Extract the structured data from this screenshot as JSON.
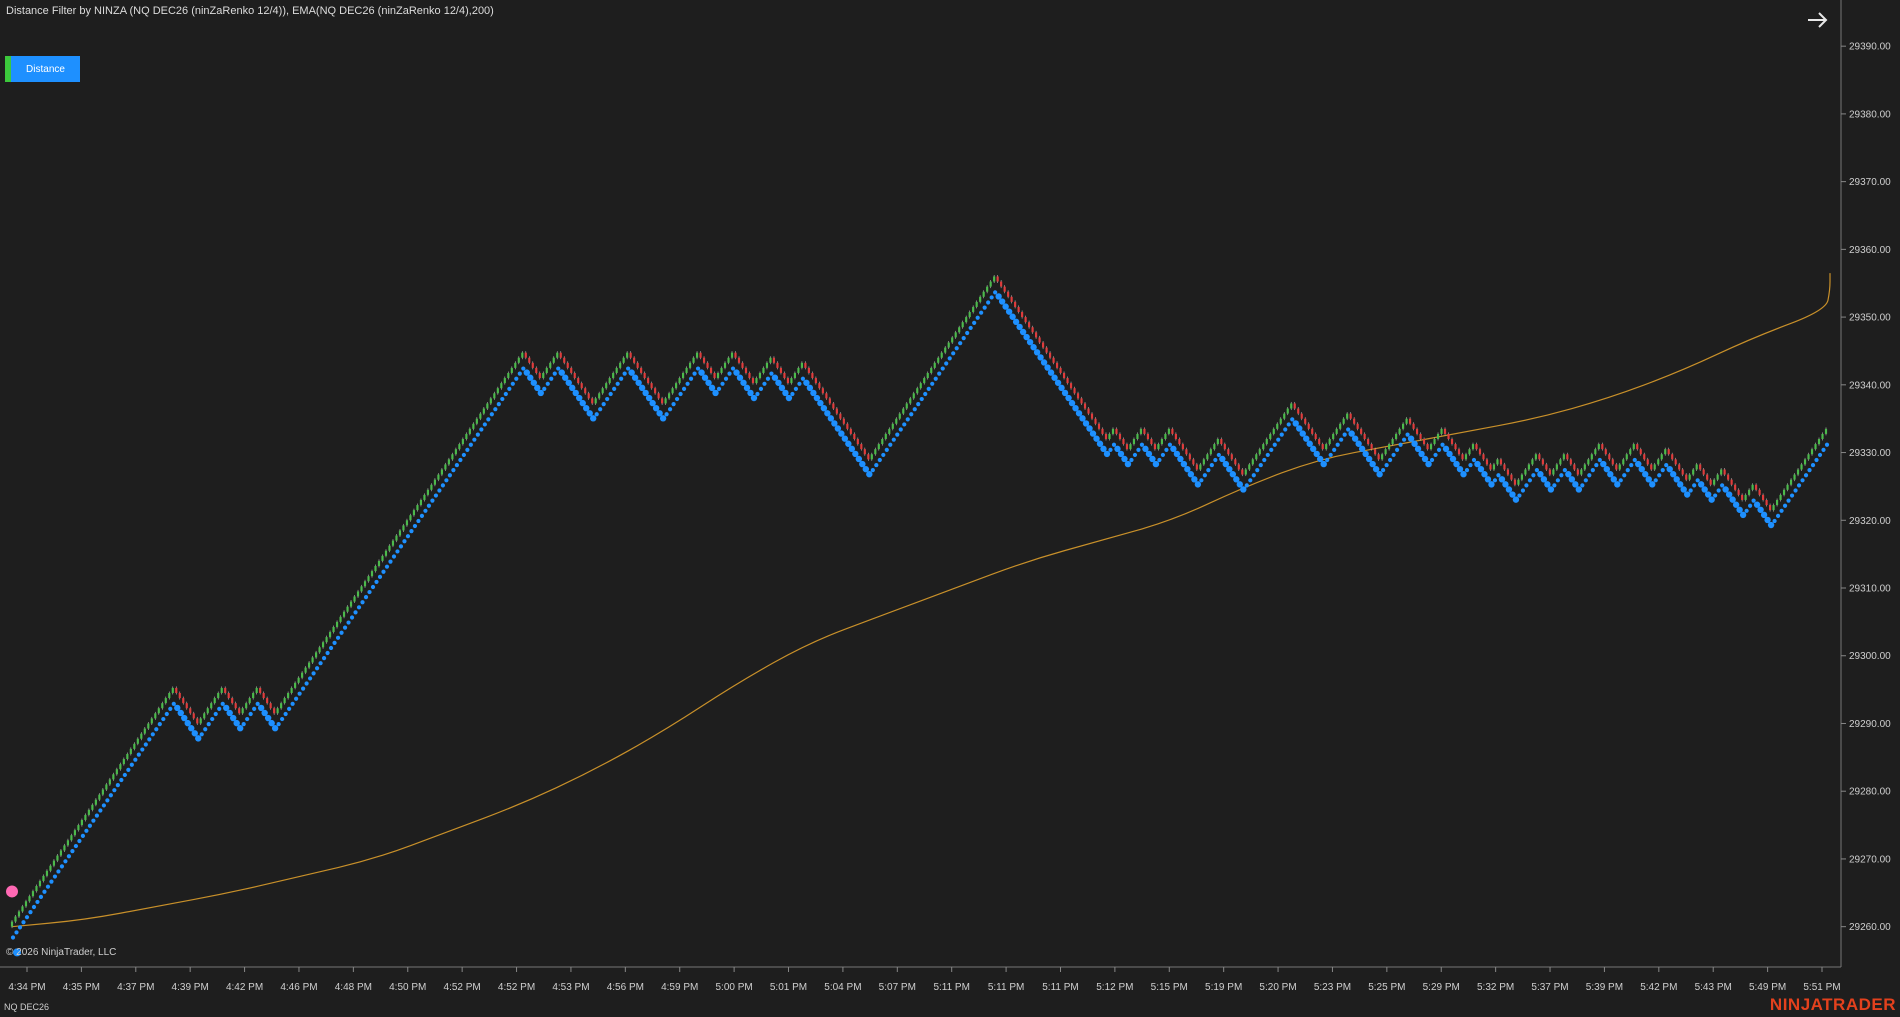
{
  "header": {
    "title": "Distance Filter by NINZA (NQ DEC26 (ninZaRenko 12/4)), EMA(NQ DEC26 (ninZaRenko 12/4),200)"
  },
  "controls": {
    "distance_button": "Distance",
    "arrow_icon": "arrow-right-icon"
  },
  "footer": {
    "copyright": "© 2026 NinjaTrader, LLC",
    "instrument": "NQ DEC26",
    "brand": "NINJATRADER"
  },
  "colors": {
    "background": "#1e1e1e",
    "up_bar": "#4cbb4c",
    "down_bar": "#e03c3c",
    "dots": "#1e90ff",
    "ema": "#c8902a",
    "signal": "#ff69b4",
    "brand": "#e4411d"
  },
  "chart_data": {
    "type": "renko",
    "ylim": [
      29254,
      29392
    ],
    "y_ticks": [
      29260,
      29270,
      29280,
      29290,
      29300,
      29310,
      29320,
      29330,
      29340,
      29350,
      29360,
      29370,
      29380,
      29390
    ],
    "y_tick_labels": [
      "29260.00",
      "29270.00",
      "29280.00",
      "29290.00",
      "29300.00",
      "29310.00",
      "29320.00",
      "29330.00",
      "29340.00",
      "29350.00",
      "29360.00",
      "29370.00",
      "29380.00",
      "29390.00"
    ],
    "x_tick_labels": [
      "4:34 PM",
      "4:35 PM",
      "4:37 PM",
      "4:39 PM",
      "4:42 PM",
      "4:46 PM",
      "4:48 PM",
      "4:50 PM",
      "4:52 PM",
      "4:52 PM",
      "4:53 PM",
      "4:56 PM",
      "4:59 PM",
      "5:00 PM",
      "5:01 PM",
      "5:04 PM",
      "5:07 PM",
      "5:11 PM",
      "5:11 PM",
      "5:11 PM",
      "5:12 PM",
      "5:15 PM",
      "5:19 PM",
      "5:20 PM",
      "5:23 PM",
      "5:25 PM",
      "5:29 PM",
      "5:32 PM",
      "5:37 PM",
      "5:39 PM",
      "5:42 PM",
      "5:43 PM",
      "5:49 PM",
      "5:51 PM"
    ],
    "brick_size": 0.75,
    "start_price": 29260,
    "legs": [
      47,
      -7,
      7,
      -5,
      5,
      -5,
      71,
      -5,
      5,
      -10,
      10,
      -10,
      10,
      -5,
      5,
      -6,
      5,
      -5,
      4,
      -7,
      -12,
      36,
      -28,
      -4,
      2,
      -4,
      4,
      -4,
      4,
      -8,
      6,
      -7,
      14,
      -9,
      7,
      -9,
      8,
      -6,
      4,
      -6,
      3,
      -5,
      2,
      -5,
      6,
      -4,
      4,
      -4,
      6,
      -5,
      5,
      -5,
      4,
      -6,
      3,
      -4,
      3,
      -6,
      3,
      -5,
      16
    ],
    "ema": [
      [
        0,
        29260
      ],
      [
        0.04,
        29261
      ],
      [
        0.08,
        29263
      ],
      [
        0.12,
        29265
      ],
      [
        0.16,
        29267.5
      ],
      [
        0.2,
        29270
      ],
      [
        0.24,
        29274
      ],
      [
        0.28,
        29278
      ],
      [
        0.32,
        29283
      ],
      [
        0.36,
        29289
      ],
      [
        0.4,
        29296
      ],
      [
        0.44,
        29302
      ],
      [
        0.48,
        29306
      ],
      [
        0.52,
        29310
      ],
      [
        0.56,
        29314
      ],
      [
        0.6,
        29317
      ],
      [
        0.64,
        29320
      ],
      [
        0.68,
        29325
      ],
      [
        0.72,
        29329
      ],
      [
        0.76,
        29331
      ],
      [
        0.8,
        29333
      ],
      [
        0.84,
        29335
      ],
      [
        0.88,
        29338
      ],
      [
        0.92,
        29342
      ],
      [
        0.96,
        29347
      ],
      [
        1,
        29351
      ],
      [
        1.04,
        29354
      ],
      [
        1.08,
        29356.5
      ]
    ]
  }
}
